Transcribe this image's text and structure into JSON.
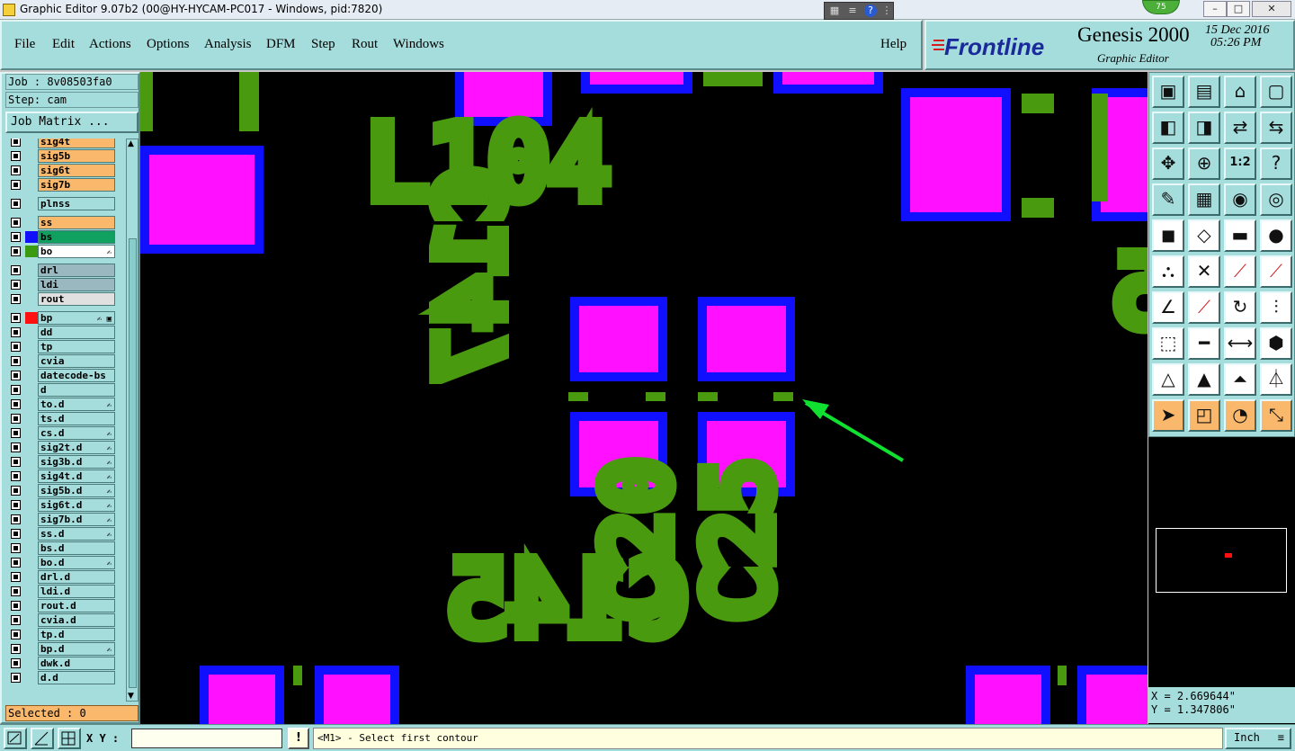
{
  "window": {
    "title": "Graphic Editor 9.07b2 (00@HY-HYCAM-PC017 - Windows, pid:7820)",
    "badge": "75",
    "controls": [
      "–",
      "□",
      "✕"
    ]
  },
  "menu": {
    "items": [
      "File",
      "Edit",
      "Actions",
      "Options",
      "Analysis",
      "DFM",
      "Step",
      "Rout",
      "Windows"
    ],
    "help": "Help"
  },
  "brand": {
    "logo_text": "Frontline",
    "product": "Genesis 2000",
    "subtitle": "Graphic Editor",
    "date": "15 Dec 2016",
    "time": "05:26 PM"
  },
  "job": {
    "job_label": "Job : 8v08503fa0",
    "step_label": "Step: cam",
    "matrix_button": "Job Matrix ...",
    "selected": "Selected : 0"
  },
  "layers": [
    {
      "name": "sig4t",
      "bg": "#f9b86c"
    },
    {
      "name": "sig5b",
      "bg": "#f9b86c"
    },
    {
      "name": "sig6t",
      "bg": "#f9b86c"
    },
    {
      "name": "sig7b",
      "bg": "#f9b86c"
    },
    {
      "name": "plnss",
      "bg": "#a5dcdc",
      "gap": true
    },
    {
      "name": "ss",
      "bg": "#f9b86c",
      "gap": true
    },
    {
      "name": "bs",
      "bg": "#10a060",
      "chip": "#1010ff"
    },
    {
      "name": "bo",
      "bg": "#ffffff",
      "chip": "#3a9a10",
      "mark": "✍"
    },
    {
      "name": "drl",
      "bg": "#9ab8c0",
      "gap": true
    },
    {
      "name": "ldi",
      "bg": "#9ab8c0"
    },
    {
      "name": "rout",
      "bg": "#e0e0e0"
    },
    {
      "name": "bp",
      "bg": "#a5dcdc",
      "chip": "#ff1010",
      "mark": "✍ ▣",
      "gap": true
    },
    {
      "name": "dd",
      "bg": "#a5dcdc"
    },
    {
      "name": "tp",
      "bg": "#a5dcdc"
    },
    {
      "name": "cvia",
      "bg": "#a5dcdc"
    },
    {
      "name": "datecode-bs",
      "bg": "#a5dcdc"
    },
    {
      "name": "d",
      "bg": "#a5dcdc"
    },
    {
      "name": "to.d",
      "bg": "#a5dcdc",
      "mark": "✍"
    },
    {
      "name": "ts.d",
      "bg": "#a5dcdc"
    },
    {
      "name": "cs.d",
      "bg": "#a5dcdc",
      "mark": "✍"
    },
    {
      "name": "sig2t.d",
      "bg": "#a5dcdc",
      "mark": "✍"
    },
    {
      "name": "sig3b.d",
      "bg": "#a5dcdc",
      "mark": "✍"
    },
    {
      "name": "sig4t.d",
      "bg": "#a5dcdc",
      "mark": "✍"
    },
    {
      "name": "sig5b.d",
      "bg": "#a5dcdc",
      "mark": "✍"
    },
    {
      "name": "sig6t.d",
      "bg": "#a5dcdc",
      "mark": "✍"
    },
    {
      "name": "sig7b.d",
      "bg": "#a5dcdc",
      "mark": "✍"
    },
    {
      "name": "ss.d",
      "bg": "#a5dcdc",
      "mark": "✍"
    },
    {
      "name": "bs.d",
      "bg": "#a5dcdc"
    },
    {
      "name": "bo.d",
      "bg": "#a5dcdc",
      "mark": "✍"
    },
    {
      "name": "drl.d",
      "bg": "#a5dcdc"
    },
    {
      "name": "ldi.d",
      "bg": "#a5dcdc"
    },
    {
      "name": "rout.d",
      "bg": "#a5dcdc"
    },
    {
      "name": "cvia.d",
      "bg": "#a5dcdc"
    },
    {
      "name": "tp.d",
      "bg": "#a5dcdc"
    },
    {
      "name": "bp.d",
      "bg": "#a5dcdc",
      "mark": "✍"
    },
    {
      "name": "dwk.d",
      "bg": "#a5dcdc"
    },
    {
      "name": "d.d",
      "bg": "#a5dcdc"
    }
  ],
  "canvas": {
    "labels": [
      "L104",
      "L105",
      "C145",
      "C159",
      "C147",
      "C20",
      "C25"
    ],
    "pad_color": "#ff10ff",
    "pad_border_color": "#1010ff",
    "silk_color": "#4a9a10",
    "arrow_color": "#10e030"
  },
  "tools": [
    "copy-icon",
    "paste-icon",
    "home-icon",
    "window-icon",
    "move-left-icon",
    "move-right-icon",
    "flip-icon",
    "mirror-icon",
    "zoom-fit-icon",
    "zoom-center-icon",
    "scale-1-2-icon",
    "help-icon",
    "measure-tool-icon",
    "grid-icon",
    "layers-icon",
    "snap-icon",
    "select-pad-icon",
    "select-line-icon",
    "ruler-icon",
    "dot-icon",
    "connect-icon",
    "cross-icon",
    "add-line-icon",
    "add-pad-icon",
    "angle-icon",
    "slash-icon",
    "rotate-icon",
    "align-icon",
    "move-pad-icon",
    "split-icon",
    "stretch-icon",
    "group-icon",
    "tri-line-icon",
    "tri-up-icon",
    "tri-arrow-icon",
    "tri-bar-icon",
    "pointer-icon",
    "select-box-icon",
    "select-circle-icon",
    "path-icon"
  ],
  "tool_scale_label": "1:2",
  "coords": {
    "x": "X = 2.669644\"",
    "y": "Y = 1.347806\""
  },
  "bottom": {
    "xy_label": "X Y :",
    "xy_value": "",
    "message_button": "!",
    "status": "<M1> - Select first contour",
    "units": "Inch"
  }
}
